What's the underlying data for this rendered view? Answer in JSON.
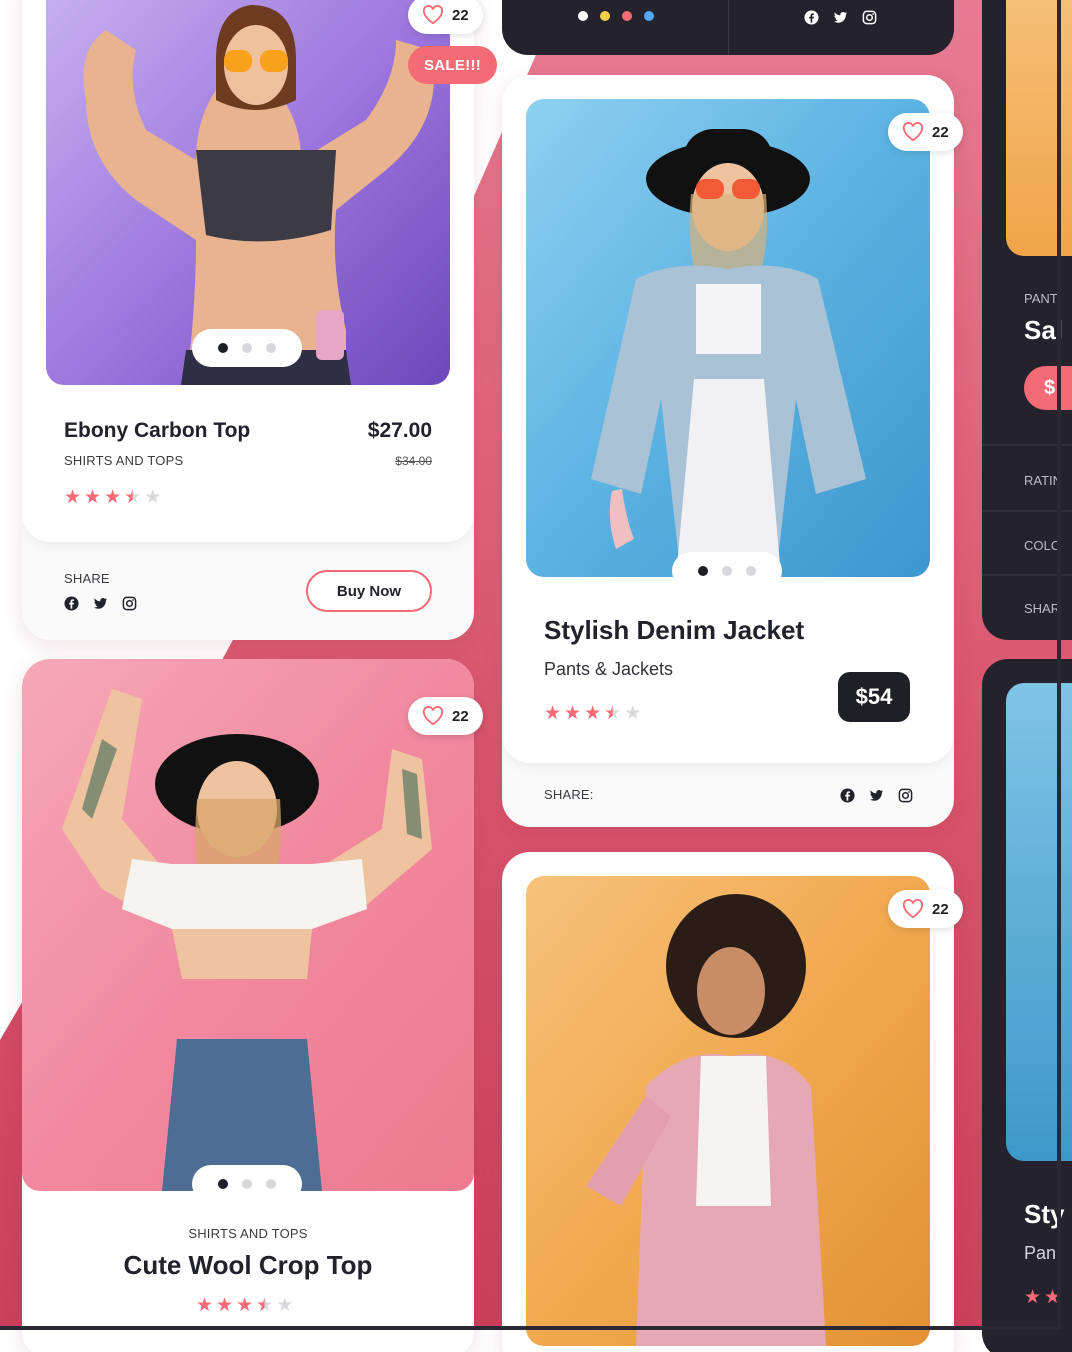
{
  "colors": {
    "accent": "#f46a75",
    "dark": "#23222d",
    "band": "#d9566e"
  },
  "top_dark_card": {
    "color_dots": [
      "#ffffff",
      "#f7d04a",
      "#f46a75",
      "#4fa8f0"
    ],
    "social_icons": [
      "facebook-icon",
      "twitter-icon",
      "instagram-icon"
    ]
  },
  "card_ebony": {
    "likes": "22",
    "sale_badge": "SALE!!!",
    "title": "Ebony Carbon Top",
    "category": "SHIRTS AND TOPS",
    "price": "$27.00",
    "old_price": "$34.00",
    "rating": 3.5,
    "share_label": "SHARE",
    "buy_button": "Buy Now"
  },
  "card_denim": {
    "likes": "22",
    "title": "Stylish Denim Jacket",
    "category": "Pants & Jackets",
    "price": "$54",
    "rating": 3.5,
    "share_label": "SHARE:"
  },
  "card_wool": {
    "likes": "22",
    "category": "SHIRTS AND TOPS",
    "title": "Cute Wool Crop Top",
    "rating": 3.5
  },
  "card_pink_suit": {
    "likes": "22"
  },
  "right_partial": {
    "category": "PANT",
    "title": "Sal",
    "button": "$",
    "rating_label": "RATIN",
    "color_label": "COLC",
    "share_label": "SHAR",
    "bottom_title": "Sty",
    "bottom_category": "Pan"
  }
}
